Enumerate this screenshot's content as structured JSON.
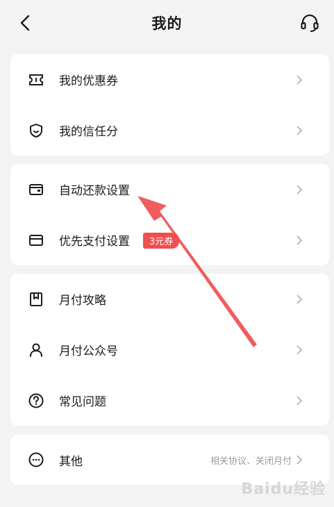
{
  "header": {
    "title": "我的"
  },
  "group1": [
    {
      "label": "我的优惠券",
      "icon": "coupon-icon"
    },
    {
      "label": "我的信任分",
      "icon": "shield-icon"
    }
  ],
  "group2": [
    {
      "label": "自动还款设置",
      "icon": "wallet-icon"
    },
    {
      "label": "优先支付设置",
      "icon": "card-icon",
      "badge": "3元券"
    }
  ],
  "group3": [
    {
      "label": "月付攻略",
      "icon": "bookmark-icon"
    },
    {
      "label": "月付公众号",
      "icon": "person-icon"
    },
    {
      "label": "常见问题",
      "icon": "help-icon"
    }
  ],
  "group4": [
    {
      "label": "其他",
      "icon": "more-icon",
      "sub": "相关协议、关闭月付"
    }
  ],
  "watermark": "Baidu经验",
  "colors": {
    "annotation": "#f04f4f",
    "badge": "#f04f4f"
  }
}
